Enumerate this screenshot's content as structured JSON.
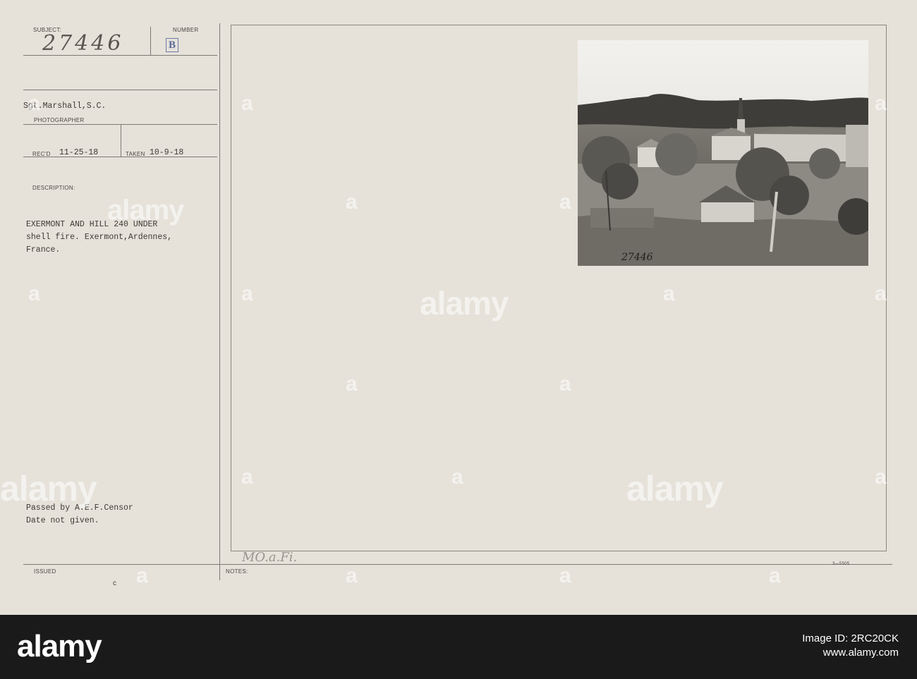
{
  "card": {
    "subject_label": "SUBJECT:",
    "subject_value": "27446",
    "number_label": "NUMBER",
    "number_value": "B",
    "photographer_name": "Sgt.Marshall,S.C.",
    "photographer_label": "PHOTOGRAPHER",
    "recd_label": "REC'D",
    "recd_value": "11-25-18",
    "taken_label": "TAKEN",
    "taken_value": "10-9-18",
    "description_label": "DESCRIPTION:",
    "description_line1": "EXERMONT AND HILL 240 UNDER",
    "description_line2": "shell fire. Exermont,Ardennes,",
    "description_line3": "France.",
    "censor_line1": "Passed by A.E.F.Censor",
    "censor_line2": "Date not given.",
    "issued_label": "ISSUED",
    "issued_value": "c",
    "notes_label": "NOTES:",
    "notes_value": "MO.a.Fi.",
    "form_number": "3—5505",
    "photo_number": "27446"
  },
  "watermark": {
    "text": "alamy",
    "letter": "a"
  },
  "footer": {
    "logo": "alamy",
    "image_id_label": "Image ID:",
    "image_id": "2RC20CK",
    "url": "www.alamy.com"
  },
  "colors": {
    "card": "#e6e2da",
    "ink": "#3d3a36",
    "footer": "#1a1a1a"
  }
}
